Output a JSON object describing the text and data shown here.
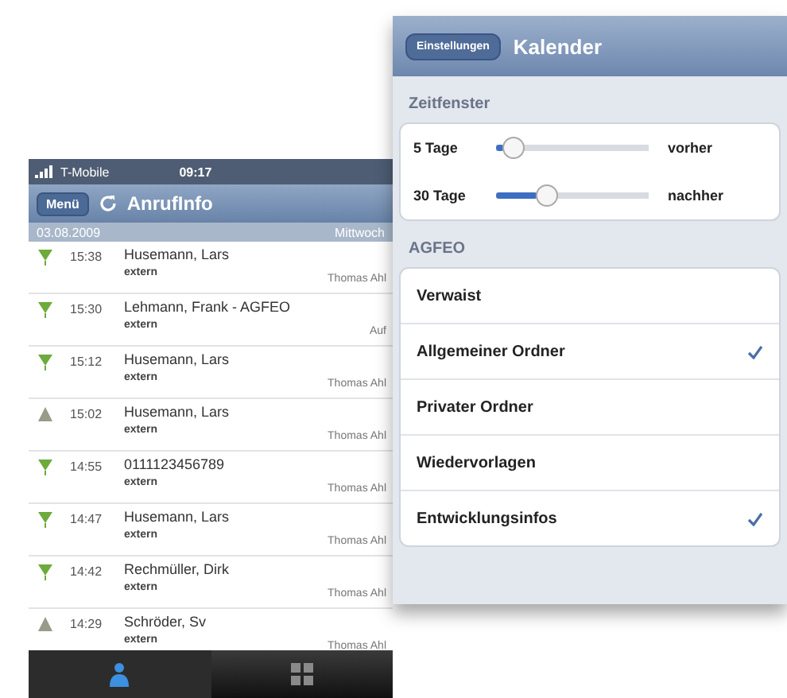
{
  "call_list": {
    "status_bar": {
      "carrier": "T-Mobile",
      "time": "09:17"
    },
    "nav_bar": {
      "back": "Menü",
      "title": "AnrufInfo"
    },
    "day_header": {
      "date": "03.08.2009",
      "weekday": "Mittwoch"
    },
    "calls": [
      {
        "kind": "incoming",
        "time": "15:38",
        "name": "Husemann, Lars",
        "type": "extern",
        "note": "Thomas Ahl"
      },
      {
        "kind": "incoming",
        "time": "15:30",
        "name": "Lehmann, Frank - AGFEO",
        "type": "extern",
        "note": "Auf"
      },
      {
        "kind": "incoming",
        "time": "15:12",
        "name": "Husemann, Lars",
        "type": "extern",
        "note": "Thomas Ahl"
      },
      {
        "kind": "outgoing",
        "time": "15:02",
        "name": "Husemann, Lars",
        "type": "extern",
        "note": "Thomas Ahl"
      },
      {
        "kind": "incoming",
        "time": "14:55",
        "name": "0111123456789",
        "type": "extern",
        "note": "Thomas Ahl"
      },
      {
        "kind": "incoming",
        "time": "14:47",
        "name": "Husemann, Lars",
        "type": "extern",
        "note": "Thomas Ahl"
      },
      {
        "kind": "incoming",
        "time": "14:42",
        "name": "Rechmüller, Dirk",
        "type": "extern",
        "note": "Thomas Ahl"
      },
      {
        "kind": "outgoing",
        "time": "14:29",
        "name": "Schröder, Sv",
        "type": "extern",
        "note": "Thomas Ahl"
      }
    ],
    "tab_bar": [
      {
        "kind": "phone",
        "selected": true
      },
      {
        "kind": "grid",
        "selected": false
      }
    ]
  },
  "settings": {
    "nav_bar": {
      "back": "Einstellungen",
      "title": "Kalender"
    },
    "sections": [
      {
        "title": "Zeitfenster",
        "rows": [
          {
            "kind": "slider",
            "label": "5 Tage",
            "level": 0.05,
            "reading": "vorher"
          },
          {
            "kind": "slider",
            "label": "30 Tage",
            "level": 0.3,
            "reading": "nachher"
          }
        ]
      },
      {
        "title": "AGFEO",
        "rows": [
          {
            "kind": "check",
            "label": "Verwaist",
            "checked": false
          },
          {
            "kind": "check",
            "label": "Allgemeiner Ordner",
            "checked": true
          },
          {
            "kind": "check",
            "label": "Privater Ordner",
            "checked": false
          },
          {
            "kind": "check",
            "label": "Wiedervorlagen",
            "checked": false
          },
          {
            "kind": "check",
            "label": "Entwicklungsinfos",
            "checked": true
          }
        ]
      }
    ]
  }
}
